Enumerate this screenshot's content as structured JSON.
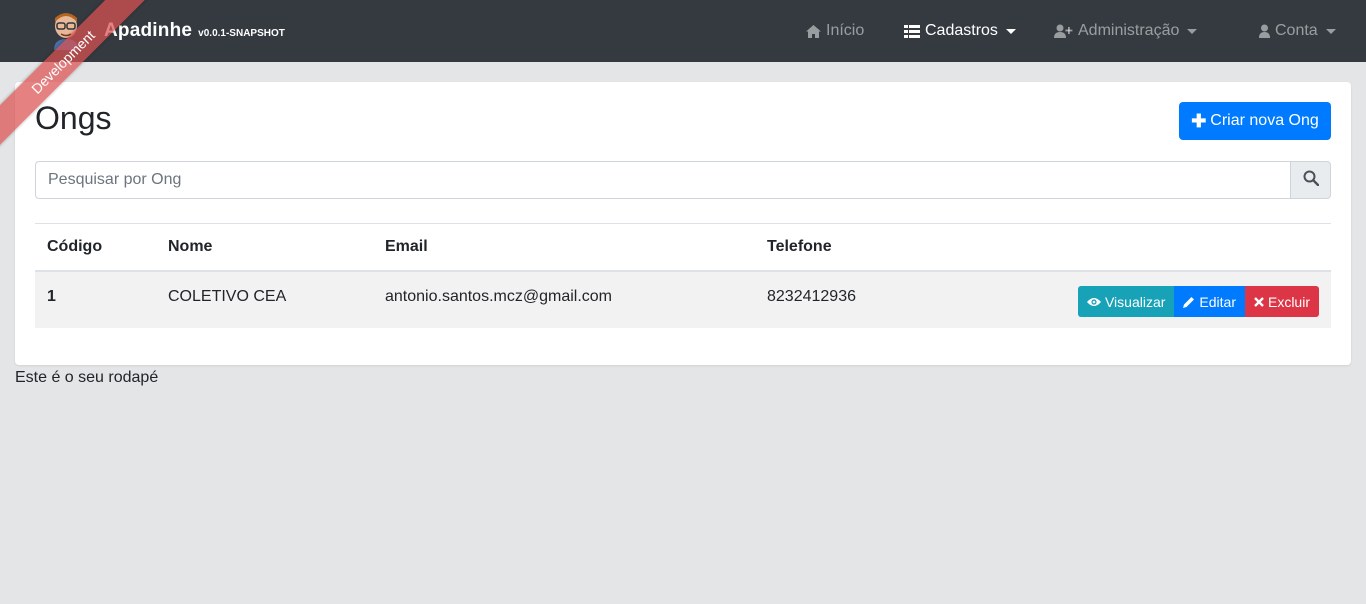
{
  "navbar": {
    "brand_title": "Apadinhe",
    "brand_version": "v0.0.1-SNAPSHOT",
    "items": [
      {
        "label": "Início",
        "icon": "home-icon"
      },
      {
        "label": "Cadastros",
        "icon": "list-icon"
      },
      {
        "label": "Administração",
        "icon": "user-plus-icon"
      },
      {
        "label": "Conta",
        "icon": "user-icon"
      }
    ]
  },
  "ribbon": {
    "label": "Development"
  },
  "page": {
    "title": "Ongs",
    "create_label": "Criar nova Ong",
    "search_placeholder": "Pesquisar por Ong"
  },
  "table": {
    "headers": [
      "Código",
      "Nome",
      "Email",
      "Telefone"
    ],
    "rows": [
      {
        "codigo": "1",
        "nome": "COLETIVO CEA",
        "email": "antonio.santos.mcz@gmail.com",
        "telefone": "8232412936"
      }
    ],
    "actions": {
      "view": "Visualizar",
      "edit": "Editar",
      "delete": "Excluir"
    }
  },
  "footer": {
    "text": "Este é o seu rodapé"
  },
  "colors": {
    "navbar": "#343a40",
    "primary": "#007bff",
    "info": "#17a2b8",
    "danger": "#dc3545",
    "ribbon": "#dc5050"
  }
}
